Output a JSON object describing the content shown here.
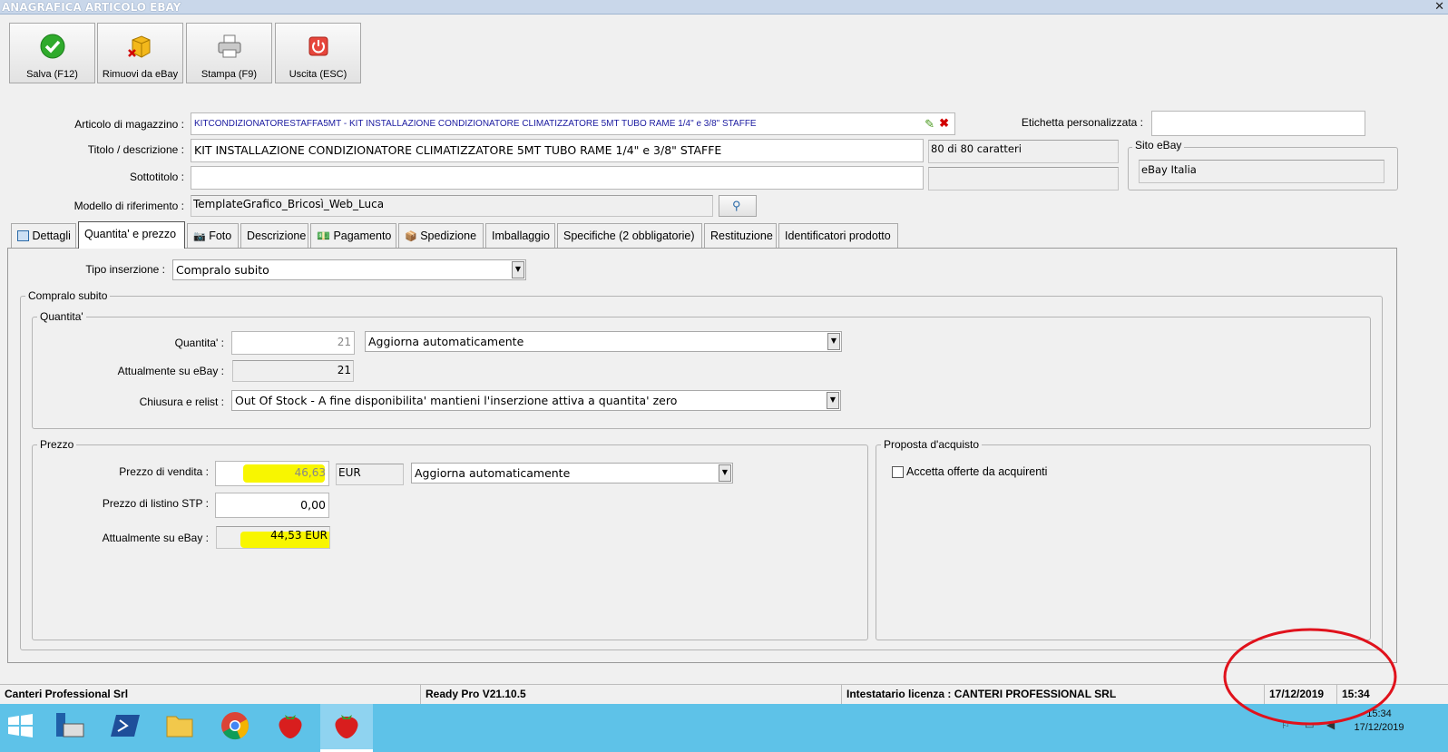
{
  "window": {
    "title": "ANAGRAFICA ARTICOLO EBAY",
    "close": "✕"
  },
  "toolbar": [
    {
      "label": "Salva (F12)",
      "icon": "check-icon"
    },
    {
      "label": "Rimuovi da eBay",
      "icon": "remove-box-icon"
    },
    {
      "label": "Stampa (F9)",
      "icon": "printer-icon"
    },
    {
      "label": "Uscita (ESC)",
      "icon": "power-icon"
    }
  ],
  "form": {
    "articolo_label": "Articolo di magazzino :",
    "articolo_value": "KITCONDIZIONATORESTAFFA5MT - KIT INSTALLAZIONE CONDIZIONATORE CLIMATIZZATORE 5MT TUBO RAME 1/4\" e 3/8\" STAFFE",
    "etichetta_label": "Etichetta personalizzata :",
    "etichetta_value": "",
    "titolo_label": "Titolo / descrizione :",
    "titolo_value": "KIT INSTALLAZIONE CONDIZIONATORE CLIMATIZZATORE 5MT TUBO RAME 1/4\" e 3/8\" STAFFE",
    "titolo_counter": "80 di 80 caratteri",
    "sito_label": "Sito eBay",
    "sito_value": "eBay Italia",
    "sottotitolo_label": "Sottotitolo :",
    "sottotitolo_value": "",
    "sottotitolo_counter": "",
    "modello_label": "Modello di riferimento :",
    "modello_value": "TemplateGrafico_Bricosì_Web_Luca"
  },
  "tabs": [
    {
      "label": "Dettagli",
      "icon": "calendar-icon"
    },
    {
      "label": "Quantita' e prezzo",
      "icon": ""
    },
    {
      "label": "Foto",
      "icon": "camera-icon"
    },
    {
      "label": "Descrizione",
      "icon": ""
    },
    {
      "label": "Pagamento",
      "icon": "money-icon"
    },
    {
      "label": "Spedizione",
      "icon": "package-icon"
    },
    {
      "label": "Imballaggio",
      "icon": ""
    },
    {
      "label": "Specifiche (2 obbligatorie)",
      "icon": ""
    },
    {
      "label": "Restituzione",
      "icon": ""
    },
    {
      "label": "Identificatori prodotto",
      "icon": ""
    }
  ],
  "active_tab": "Quantita' e prezzo",
  "listing": {
    "tipo_label": "Tipo inserzione :",
    "tipo_value": "Compralo subito",
    "group_title": "Compralo subito"
  },
  "quantita": {
    "group_title": "Quantita'",
    "quantita_label": "Quantita' :",
    "quantita_value": "21",
    "aggiorna_value": "Aggiorna automaticamente",
    "attuale_label": "Attualmente su eBay :",
    "attuale_value": "21",
    "chiusura_label": "Chiusura e relist :",
    "chiusura_value": "Out Of Stock - A fine disponibilita' mantieni l'inserzione attiva a quantita' zero"
  },
  "prezzo": {
    "group_title": "Prezzo",
    "vendita_label": "Prezzo di vendita :",
    "vendita_value": "46,63",
    "currency": "EUR",
    "aggiorna_value": "Aggiorna automaticamente",
    "listino_label": "Prezzo di listino STP :",
    "listino_value": "0,00",
    "attuale_label": "Attualmente su eBay :",
    "attuale_value": "44,53 EUR"
  },
  "proposta": {
    "group_title": "Proposta d'acquisto",
    "accetta_label": "Accetta offerte da acquirenti",
    "accetta_checked": false
  },
  "status_bar": {
    "company": "Canteri Professional Srl",
    "version": "Ready Pro V21.10.5",
    "license": "Intestatario licenza : CANTERI PROFESSIONAL SRL",
    "date": "17/12/2019",
    "time": "15:34"
  },
  "taskbar": {
    "clock_time": "15:34",
    "clock_date": "17/12/2019"
  },
  "colors": {
    "highlight": "#f8f600",
    "annotation": "#e0121c",
    "taskbar": "#5ec2e8"
  }
}
